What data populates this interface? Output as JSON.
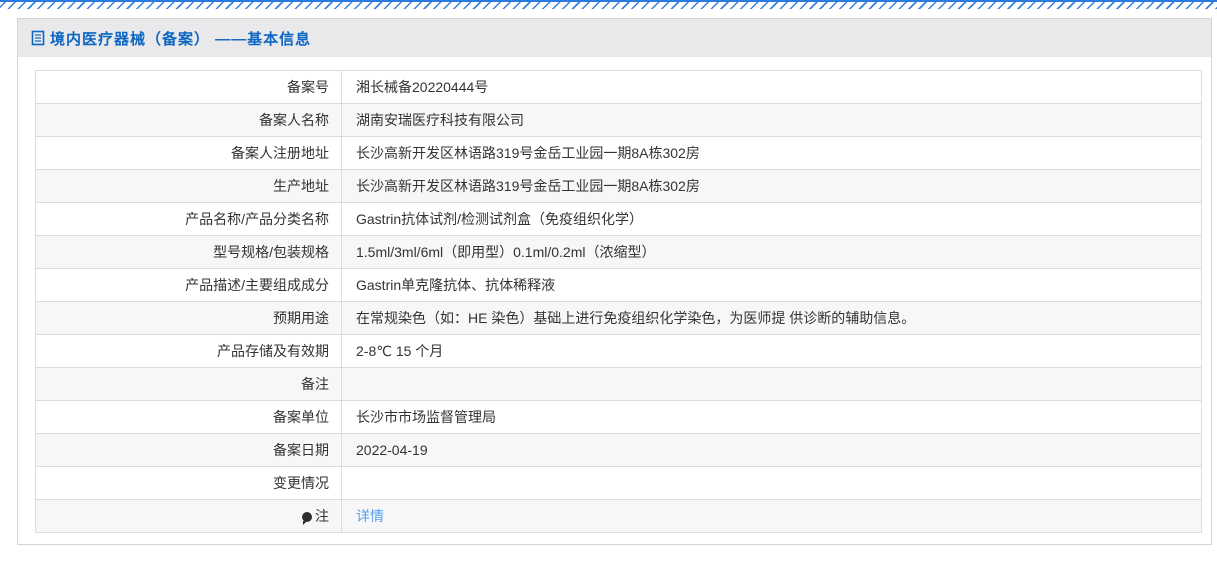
{
  "header": {
    "title": "境内医疗器械（备案） ——基本信息"
  },
  "colors": {
    "stripe_blue": "#2b7ae0",
    "title_blue": "#0d66c2",
    "link_blue": "#549ff6",
    "header_band_gray": "#e9e9eb",
    "row_alt_gray": "#f7f7f7",
    "border_gray": "#dcdcde",
    "text_dark": "#333333"
  },
  "icons": {
    "title_icon": "document-icon",
    "note_icon": "note-balloon-icon"
  },
  "table": {
    "rows": [
      {
        "label": "备案号",
        "value": "湘长械备20220444号"
      },
      {
        "label": "备案人名称",
        "value": "湖南安瑞医疗科技有限公司"
      },
      {
        "label": "备案人注册地址",
        "value": "长沙高新开发区林语路319号金岳工业园一期8A栋302房"
      },
      {
        "label": "生产地址",
        "value": "长沙高新开发区林语路319号金岳工业园一期8A栋302房"
      },
      {
        "label": "产品名称/产品分类名称",
        "value": "Gastrin抗体试剂/检测试剂盒（免疫组织化学）"
      },
      {
        "label": "型号规格/包装规格",
        "value": "1.5ml/3ml/6ml（即用型）0.1ml/0.2ml（浓缩型）"
      },
      {
        "label": "产品描述/主要组成成分",
        "value": "Gastrin单克隆抗体、抗体稀释液"
      },
      {
        "label": "预期用途",
        "value": "在常规染色（如：HE 染色）基础上进行免疫组织化学染色，为医师提 供诊断的辅助信息。"
      },
      {
        "label": "产品存储及有效期",
        "value": "2-8℃ 15 个月"
      },
      {
        "label": "备注",
        "value": ""
      },
      {
        "label": "备案单位",
        "value": "长沙市市场监督管理局"
      },
      {
        "label": "备案日期",
        "value": "2022-04-19"
      },
      {
        "label": "变更情况",
        "value": ""
      },
      {
        "label": "注",
        "value": "",
        "icon": "note-balloon-icon",
        "link": "详情"
      }
    ]
  }
}
